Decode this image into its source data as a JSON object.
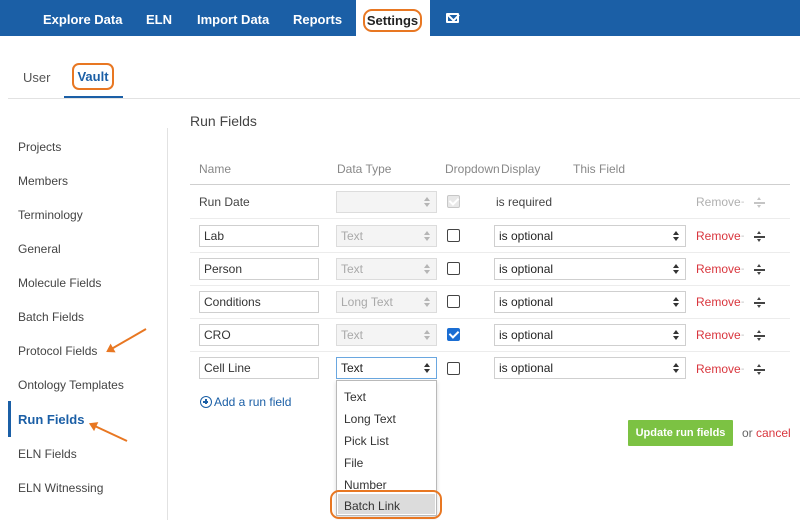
{
  "topnav": {
    "items": [
      "Explore Data",
      "ELN",
      "Import Data",
      "Reports",
      "Settings"
    ],
    "mail_icon": "envelope-icon",
    "background": "#1b5fa6"
  },
  "subtabs": {
    "user": "User",
    "vault": "Vault"
  },
  "sidebar": {
    "items": [
      "Projects",
      "Members",
      "Terminology",
      "General",
      "Molecule Fields",
      "Batch Fields",
      "Protocol Fields",
      "Ontology Templates",
      "Run Fields",
      "ELN Fields",
      "ELN Witnessing"
    ],
    "active": "Run Fields"
  },
  "main": {
    "title": "Run Fields",
    "columns": [
      "Name",
      "Data Type",
      "Dropdown",
      "Display",
      "This Field"
    ],
    "rows": [
      {
        "name": "Run Date",
        "type": "",
        "checked": true,
        "disabled": true,
        "display": "is required",
        "remove": "Remove"
      },
      {
        "name": "Lab",
        "type": "Text",
        "checked": false,
        "disabled": false,
        "display": "is optional",
        "remove": "Remove"
      },
      {
        "name": "Person",
        "type": "Text",
        "checked": false,
        "disabled": false,
        "display": "is optional",
        "remove": "Remove"
      },
      {
        "name": "Conditions",
        "type": "Long Text",
        "checked": false,
        "disabled": false,
        "display": "is optional",
        "remove": "Remove"
      },
      {
        "name": "CRO",
        "type": "Text",
        "checked": true,
        "disabled": false,
        "display": "is optional",
        "remove": "Remove"
      },
      {
        "name": "Cell Line",
        "type": "Text",
        "checked": false,
        "disabled": false,
        "display": "is optional",
        "remove": "Remove"
      }
    ],
    "add_link": "Add a run field",
    "type_options": [
      "Text",
      "Long Text",
      "Pick List",
      "File",
      "Number",
      "Batch Link"
    ],
    "highlighted_option": "Batch Link",
    "update_button": "Update run fields",
    "or_text": "or",
    "cancel_link": "cancel"
  },
  "colors": {
    "accent": "#1b5fa6",
    "annotation": "#e87722",
    "remove": "#d9363e",
    "update": "#7cc243"
  }
}
